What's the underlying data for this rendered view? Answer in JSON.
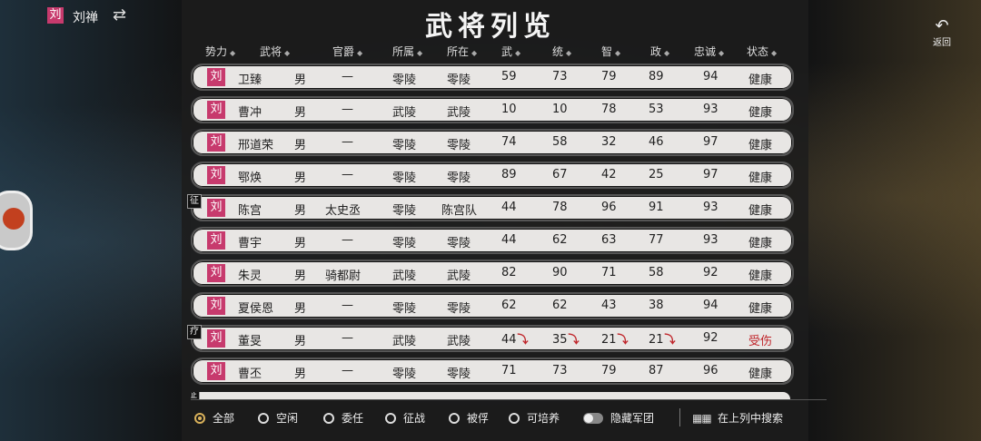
{
  "header": {
    "faction_char": "刘",
    "ruler_name": "刘禅",
    "swap_icon": "⇄",
    "title": "武将列览",
    "back_icon": "↶",
    "back_label": "返回"
  },
  "columns": [
    "势力",
    "武将",
    "官爵",
    "所属",
    "所在",
    "武",
    "统",
    "智",
    "政",
    "忠诚",
    "状态"
  ],
  "sort_icon": "◆",
  "rows": [
    {
      "faction": "刘",
      "name": "卫臻",
      "gender": "男",
      "rank": "—",
      "belong": "零陵",
      "location": "零陵",
      "wu": "59",
      "tong": "73",
      "zhi": "79",
      "zheng": "89",
      "loyalty": "94",
      "status": "健康",
      "tag": "",
      "down": false
    },
    {
      "faction": "刘",
      "name": "曹冲",
      "gender": "男",
      "rank": "—",
      "belong": "武陵",
      "location": "武陵",
      "wu": "10",
      "tong": "10",
      "zhi": "78",
      "zheng": "53",
      "loyalty": "93",
      "status": "健康",
      "tag": "",
      "down": false
    },
    {
      "faction": "刘",
      "name": "邢道荣",
      "gender": "男",
      "rank": "—",
      "belong": "零陵",
      "location": "零陵",
      "wu": "74",
      "tong": "58",
      "zhi": "32",
      "zheng": "46",
      "loyalty": "97",
      "status": "健康",
      "tag": "",
      "down": false
    },
    {
      "faction": "刘",
      "name": "鄂焕",
      "gender": "男",
      "rank": "—",
      "belong": "零陵",
      "location": "零陵",
      "wu": "89",
      "tong": "67",
      "zhi": "42",
      "zheng": "25",
      "loyalty": "97",
      "status": "健康",
      "tag": "",
      "down": false
    },
    {
      "faction": "刘",
      "name": "陈宫",
      "gender": "男",
      "rank": "太史丞",
      "belong": "零陵",
      "location": "陈宫队",
      "wu": "44",
      "tong": "78",
      "zhi": "96",
      "zheng": "91",
      "loyalty": "93",
      "status": "健康",
      "tag": "征",
      "down": false
    },
    {
      "faction": "刘",
      "name": "曹宇",
      "gender": "男",
      "rank": "—",
      "belong": "零陵",
      "location": "零陵",
      "wu": "44",
      "tong": "62",
      "zhi": "63",
      "zheng": "77",
      "loyalty": "93",
      "status": "健康",
      "tag": "",
      "down": false
    },
    {
      "faction": "刘",
      "name": "朱灵",
      "gender": "男",
      "rank": "骑都尉",
      "belong": "武陵",
      "location": "武陵",
      "wu": "82",
      "tong": "90",
      "zhi": "71",
      "zheng": "58",
      "loyalty": "92",
      "status": "健康",
      "tag": "",
      "down": false
    },
    {
      "faction": "刘",
      "name": "夏侯恩",
      "gender": "男",
      "rank": "—",
      "belong": "零陵",
      "location": "零陵",
      "wu": "62",
      "tong": "62",
      "zhi": "43",
      "zheng": "38",
      "loyalty": "94",
      "status": "健康",
      "tag": "",
      "down": false
    },
    {
      "faction": "刘",
      "name": "董旻",
      "gender": "男",
      "rank": "—",
      "belong": "武陵",
      "location": "武陵",
      "wu": "44",
      "tong": "35",
      "zhi": "21",
      "zheng": "21",
      "loyalty": "92",
      "status": "受伤",
      "tag": "疗",
      "down": true
    },
    {
      "faction": "刘",
      "name": "曹丕",
      "gender": "男",
      "rank": "—",
      "belong": "零陵",
      "location": "零陵",
      "wu": "71",
      "tong": "73",
      "zhi": "79",
      "zheng": "87",
      "loyalty": "96",
      "status": "健康",
      "tag": "",
      "down": false
    }
  ],
  "partial_row_tag": "征",
  "down_arrow": "⤵",
  "filters": [
    {
      "label": "全部",
      "selected": true
    },
    {
      "label": "空闲",
      "selected": false
    },
    {
      "label": "委任",
      "selected": false
    },
    {
      "label": "征战",
      "selected": false
    },
    {
      "label": "被俘",
      "selected": false
    },
    {
      "label": "可培养",
      "selected": false
    }
  ],
  "hide_army_label": "隐藏军团",
  "keyboard_icon": "▦▦",
  "search_label": "在上列中搜索",
  "colors": {
    "faction": "#c73a6d",
    "injured": "#c0262b",
    "radio_selected": "#d8b05a"
  }
}
